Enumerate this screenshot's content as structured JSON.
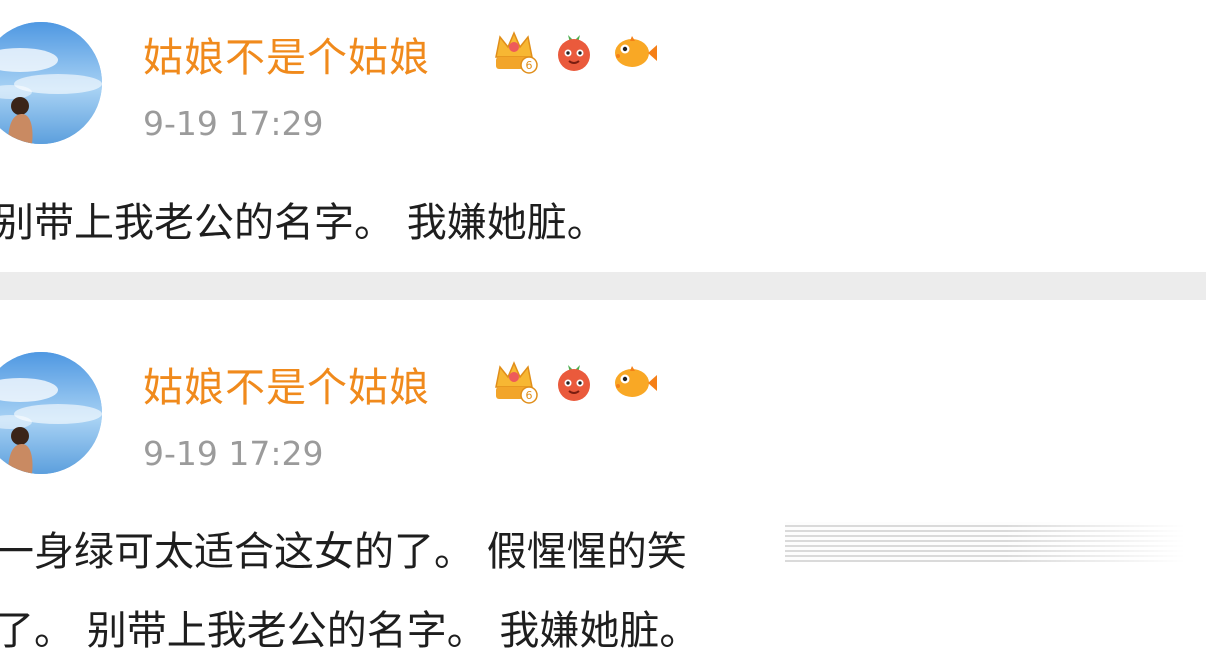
{
  "posts": [
    {
      "username": "姑娘不是个姑娘",
      "level_badge": "6",
      "badge_icons": [
        "crown-level-badge-icon",
        "red-mascot-icon",
        "pufferfish-icon"
      ],
      "timestamp": "9-19 17:29",
      "content_lines": [
        "别带上我老公的名字。 我嫌她脏。"
      ]
    },
    {
      "username": "姑娘不是个姑娘",
      "level_badge": "6",
      "badge_icons": [
        "crown-level-badge-icon",
        "red-mascot-icon",
        "pufferfish-icon"
      ],
      "timestamp": "9-19 17:29",
      "content_lines": [
        "一身绿可太适合这女的了。 假惺惺的笑",
        "了。 别带上我老公的名字。 我嫌她脏。"
      ]
    }
  ],
  "colors": {
    "username": "#f08a1c",
    "timestamp": "#9b9b9b",
    "content": "#1e1e1e",
    "divider": "#ececec"
  }
}
